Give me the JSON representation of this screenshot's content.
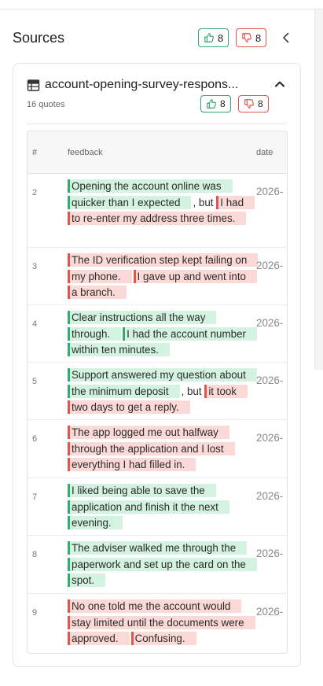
{
  "panel": {
    "title": "Sources",
    "upvotes": "8",
    "downvotes": "8",
    "collapse_icon": "chevron-left-icon"
  },
  "source": {
    "name": "account-opening-survey-respons...",
    "quote_count": "16 quotes",
    "upvotes": "8",
    "downvotes": "8",
    "icon": "table-icon",
    "toggle_icon": "chevron-up-icon"
  },
  "table": {
    "columns": [
      "#",
      "feedback",
      "date"
    ],
    "rows": [
      {
        "num": "2",
        "date": "2026-",
        "segments": [
          {
            "type": "pos",
            "text": "Opening the account online was quicker than I expected"
          },
          {
            "type": "plain",
            "text": ", but "
          },
          {
            "type": "neg",
            "text": "I had to re-enter my address three times."
          }
        ]
      },
      {
        "num": "3",
        "date": "2026-",
        "segments": [
          {
            "type": "neg",
            "text": "The ID verification step kept failing on my phone."
          },
          {
            "type": "neg",
            "text": "I gave up and went into a branch."
          }
        ]
      },
      {
        "num": "4",
        "date": "2026-",
        "segments": [
          {
            "type": "pos",
            "text": "Clear instructions all the way through."
          },
          {
            "type": "pos",
            "text": "I had the account number within ten minutes."
          }
        ]
      },
      {
        "num": "5",
        "date": "2026-",
        "segments": [
          {
            "type": "pos",
            "text": "Support answered my question about the minimum deposit"
          },
          {
            "type": "plain",
            "text": ", but "
          },
          {
            "type": "neg",
            "text": "it took two days to get a reply."
          }
        ]
      },
      {
        "num": "6",
        "date": "2026-",
        "segments": [
          {
            "type": "neg",
            "text": "The app logged me out halfway through the application and I lost everything I had filled in."
          }
        ]
      },
      {
        "num": "7",
        "date": "2026-",
        "segments": [
          {
            "type": "pos",
            "text": "I liked being able to save the application and finish it the next evening."
          }
        ]
      },
      {
        "num": "8",
        "date": "2026-",
        "segments": [
          {
            "type": "pos",
            "text": "The adviser walked me through the paperwork and set up the card on the spot."
          }
        ]
      },
      {
        "num": "9",
        "date": "2026-",
        "segments": [
          {
            "type": "neg",
            "text": "No one told me the account would stay limited until the documents were approved."
          },
          {
            "type": "neg",
            "text": "Confusing."
          }
        ]
      }
    ]
  },
  "colors": {
    "positive": "#2fae70",
    "positive_bg": "#d3f2df",
    "negative": "#e2554e",
    "negative_bg": "#fbd9d7"
  }
}
